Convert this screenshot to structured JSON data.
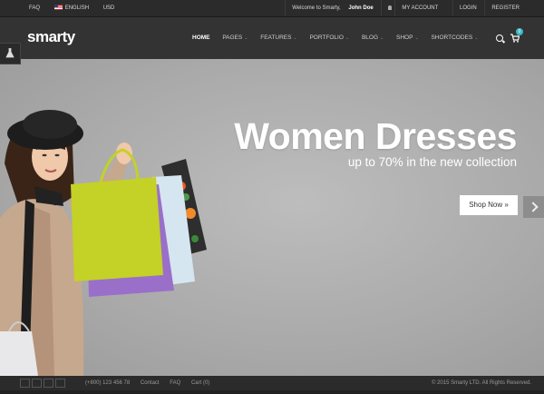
{
  "topbar": {
    "faq": "FAQ",
    "language": "ENGLISH",
    "currency": "USD",
    "welcome_prefix": "Welcome to Smarty,",
    "user_name": "John Doe",
    "my_account": "MY ACCOUNT",
    "login": "LOGIN",
    "register": "REGISTER"
  },
  "header": {
    "logo": "smarty",
    "nav": [
      "HOME",
      "PAGES",
      "FEATURES",
      "PORTFOLIO",
      "BLOG",
      "SHOP",
      "SHORTCODES"
    ],
    "active_nav": "HOME",
    "cart_count": "0",
    "accent_color": "#3fb7c4"
  },
  "hero": {
    "headline": "Women Dresses",
    "subline": "up to 70% in the new collection",
    "cta": "Shop Now »"
  },
  "footer": {
    "phone": "(+800) 123 456 78",
    "contact": "Contact",
    "faq": "FAQ",
    "cart": "Cart (0)",
    "copyright": "© 2015 Smarty LTD. All Rights Reserved."
  }
}
